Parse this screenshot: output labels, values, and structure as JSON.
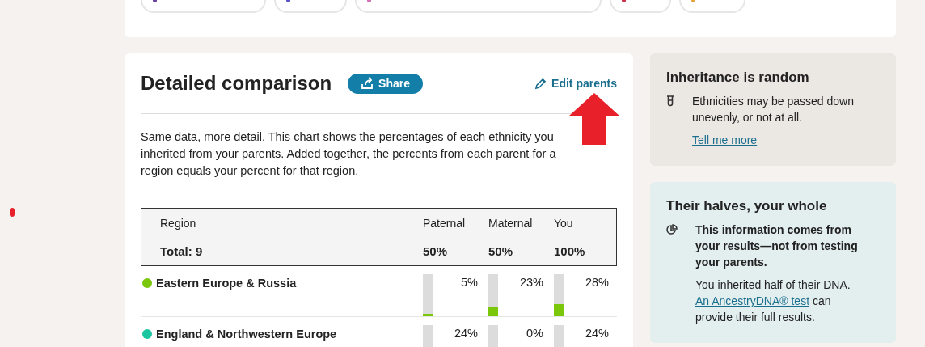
{
  "region_chips": [
    {
      "color": "#6b3fa0"
    },
    {
      "color": "#5a4fcf"
    },
    {
      "color": "#d36fb5"
    },
    {
      "color": "#d0304a"
    },
    {
      "color": "#e8a33a"
    }
  ],
  "comparison": {
    "title": "Detailed comparison",
    "share_button": "Share",
    "edit_link": "Edit parents",
    "description": "Same data, more detail. This chart shows the percentages of each ethnicity you inherited from your parents. Added together, the percents from each parent for a region equals your percent for that region.",
    "table": {
      "columns": [
        "Region",
        "Paternal",
        "Maternal",
        "You"
      ],
      "totals": [
        "Total: 9",
        "50%",
        "50%",
        "100%"
      ],
      "rows": [
        {
          "region": "Eastern Europe & Russia",
          "color": "#7ac70c",
          "values": [
            {
              "text": "5%",
              "level": 0.05
            },
            {
              "text": "23%",
              "level": 0.23
            },
            {
              "text": "28%",
              "level": 0.28
            }
          ]
        },
        {
          "region": "England & Northwestern Europe",
          "color": "#1ac6a0",
          "values": [
            {
              "text": "24%"
            },
            {
              "text": "0%"
            },
            {
              "text": "24%"
            }
          ]
        }
      ]
    }
  },
  "side_cards": [
    {
      "kind": "random",
      "title": "Inheritance is random",
      "body": "Ethnicities may be passed down unevenly, or not at all.",
      "link": "Tell me more"
    },
    {
      "kind": "halves",
      "title": "Their halves, your whole",
      "body": "This information comes from your results—not from testing your parents.",
      "note_before": "You inherited half of their DNA.",
      "link": "An AncestryDNA® test",
      "note_after": "can provide their full results."
    }
  ]
}
